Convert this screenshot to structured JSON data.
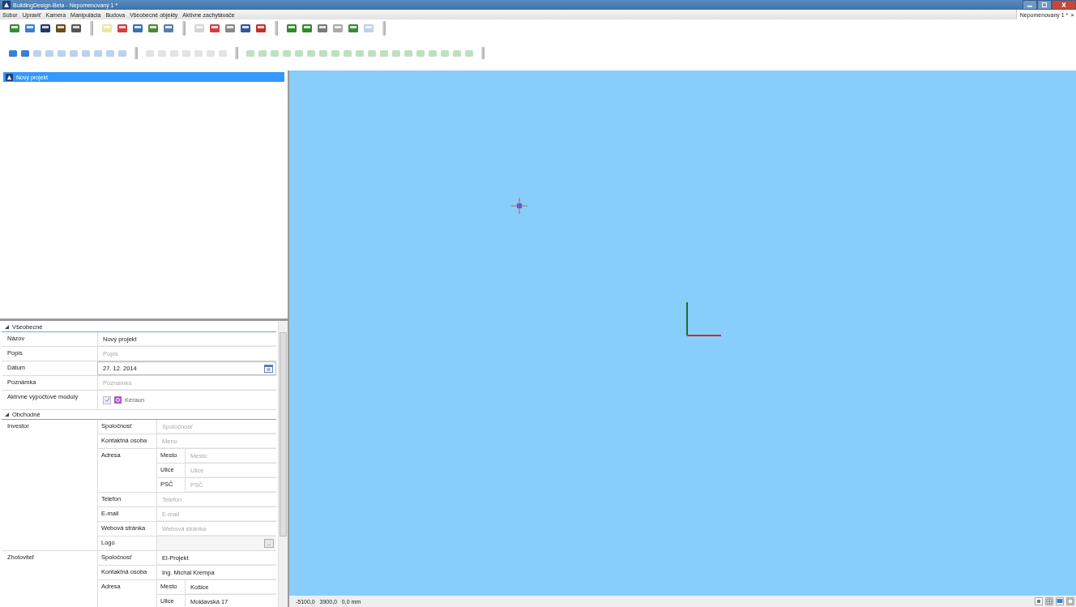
{
  "window": {
    "title": "BuildingDesign-Beta - Nepomenovaný 1 *"
  },
  "menu": [
    "Súbor",
    "Upraviť",
    "Kamera",
    "Manipulácia",
    "Budova",
    "Všeobecné objekty",
    "Aktívne zachytávače"
  ],
  "document_tab": {
    "label": "Nepomenovaný 1 *",
    "close": "×",
    "selected": true
  },
  "toolbar_1": [
    {
      "kind": "button",
      "disabled": false
    },
    {
      "kind": "button",
      "disabled": false
    },
    {
      "kind": "button",
      "disabled": false
    },
    {
      "kind": "button",
      "disabled": false
    },
    {
      "kind": "button",
      "disabled": false
    },
    {
      "kind": "separator"
    },
    {
      "kind": "button",
      "disabled": true
    },
    {
      "kind": "button",
      "disabled": false
    },
    {
      "kind": "button",
      "disabled": false
    },
    {
      "kind": "button",
      "disabled": false
    },
    {
      "kind": "button",
      "disabled": false
    },
    {
      "kind": "separator"
    },
    {
      "kind": "button",
      "disabled": true
    },
    {
      "kind": "button",
      "disabled": false
    },
    {
      "kind": "button",
      "disabled": false
    },
    {
      "kind": "button",
      "disabled": false
    },
    {
      "kind": "button",
      "disabled": false
    },
    {
      "kind": "separator"
    },
    {
      "kind": "button",
      "disabled": false
    },
    {
      "kind": "button",
      "disabled": false
    },
    {
      "kind": "button",
      "disabled": false
    },
    {
      "kind": "button",
      "disabled": false
    },
    {
      "kind": "button",
      "disabled": false
    },
    {
      "kind": "button",
      "disabled": true
    },
    {
      "kind": "separator"
    }
  ],
  "toolbar_2": [
    {
      "kind": "button",
      "disabled": false
    },
    {
      "kind": "button",
      "disabled": false
    },
    {
      "kind": "button",
      "disabled": true
    },
    {
      "kind": "button",
      "disabled": true
    },
    {
      "kind": "button",
      "disabled": true
    },
    {
      "kind": "button",
      "disabled": true
    },
    {
      "kind": "button",
      "disabled": true
    },
    {
      "kind": "button",
      "disabled": true
    },
    {
      "kind": "button",
      "disabled": true
    },
    {
      "kind": "button",
      "disabled": true
    },
    {
      "kind": "separator"
    },
    {
      "kind": "button",
      "disabled": true
    },
    {
      "kind": "button",
      "disabled": true
    },
    {
      "kind": "button",
      "disabled": true
    },
    {
      "kind": "button",
      "disabled": true
    },
    {
      "kind": "button",
      "disabled": true
    },
    {
      "kind": "button",
      "disabled": true
    },
    {
      "kind": "button",
      "disabled": true
    },
    {
      "kind": "separator"
    },
    {
      "kind": "button",
      "disabled": true
    },
    {
      "kind": "button",
      "disabled": true
    },
    {
      "kind": "button",
      "disabled": true
    },
    {
      "kind": "button",
      "disabled": true
    },
    {
      "kind": "button",
      "disabled": true
    },
    {
      "kind": "button",
      "disabled": true
    },
    {
      "kind": "button",
      "disabled": true
    },
    {
      "kind": "button",
      "disabled": true
    },
    {
      "kind": "button",
      "disabled": true
    },
    {
      "kind": "button",
      "disabled": true
    },
    {
      "kind": "button",
      "disabled": true
    },
    {
      "kind": "button",
      "disabled": true
    },
    {
      "kind": "button",
      "disabled": true
    },
    {
      "kind": "button",
      "disabled": true
    },
    {
      "kind": "button",
      "disabled": true
    },
    {
      "kind": "button",
      "disabled": true
    },
    {
      "kind": "button",
      "disabled": true
    },
    {
      "kind": "button",
      "disabled": true
    },
    {
      "kind": "button",
      "disabled": true
    },
    {
      "kind": "separator"
    }
  ],
  "tree": {
    "items": [
      {
        "label": "Nový projekt",
        "selected": true
      }
    ]
  },
  "properties": {
    "sections": [
      {
        "title": "Všeobecné",
        "expanded": true,
        "rows": [
          {
            "kind": "field",
            "label": "Názov",
            "value": "Nový projekt"
          },
          {
            "kind": "field",
            "label": "Popis",
            "placeholder": "Popis"
          },
          {
            "kind": "date",
            "label": "Dátum",
            "value": "27. 12. 2014"
          },
          {
            "kind": "field",
            "label": "Poznámka",
            "placeholder": "Poznámka"
          },
          {
            "kind": "modules",
            "label": "Aktívne výpočtové moduly",
            "checked": true,
            "module": "Keraun"
          }
        ]
      },
      {
        "title": "Obchodné",
        "expanded": true,
        "rows": [
          {
            "kind": "group",
            "label": "Investor",
            "rows": [
              {
                "kind": "field",
                "label": "Spoločnosť",
                "placeholder": "Spoločnosť"
              },
              {
                "kind": "field",
                "label": "Kontaktná osoba",
                "placeholder": "Meno"
              },
              {
                "kind": "group",
                "label": "Adresa",
                "rows": [
                  {
                    "kind": "field",
                    "label": "Mesto",
                    "placeholder": "Mesto"
                  },
                  {
                    "kind": "field",
                    "label": "Ulice",
                    "placeholder": "Ulice"
                  },
                  {
                    "kind": "field",
                    "label": "PSČ",
                    "placeholder": "PSČ"
                  }
                ]
              },
              {
                "kind": "field",
                "label": "Telefon",
                "placeholder": "Telefon"
              },
              {
                "kind": "field",
                "label": "E-mail",
                "placeholder": "E-mail"
              },
              {
                "kind": "field",
                "label": "Webová stránka",
                "placeholder": "Webová stránka"
              },
              {
                "kind": "browse",
                "label": "Logo",
                "button": "..."
              }
            ]
          },
          {
            "kind": "group",
            "label": "Zhotoviteľ",
            "rows": [
              {
                "kind": "field",
                "label": "Spoločnosť",
                "value": "El-Projekt"
              },
              {
                "kind": "field",
                "label": "Kontaktná osoba",
                "value": "Ing. Michal Krempa"
              },
              {
                "kind": "group",
                "label": "Adresa",
                "rows": [
                  {
                    "kind": "field",
                    "label": "Mesto",
                    "value": "Košice"
                  },
                  {
                    "kind": "field",
                    "label": "Ulice",
                    "value": "Moldavská 17"
                  }
                ]
              }
            ]
          }
        ]
      }
    ]
  },
  "status_bar": {
    "coordinates": "-5100,0   3900,0   0,0 mm"
  }
}
